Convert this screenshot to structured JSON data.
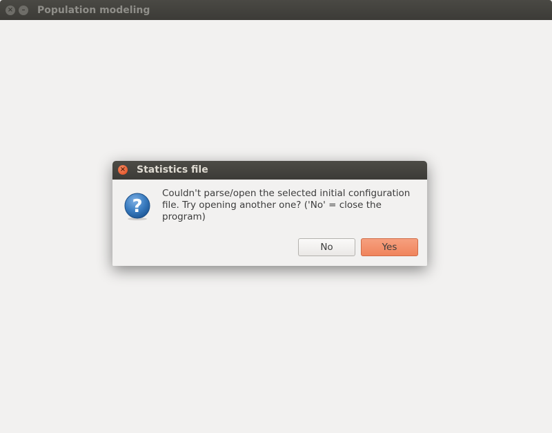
{
  "main_window": {
    "title": "Population modeling",
    "close_glyph": "×",
    "minimize_glyph": "–"
  },
  "dialog": {
    "title": "Statistics file",
    "close_glyph": "×",
    "icon": "question-icon",
    "message_line1": "Couldn't parse/open the selected initial configuration",
    "message_line2": "file. Try opening another one? ('No' = close the program)",
    "no_label": "No",
    "yes_label": "Yes"
  },
  "colors": {
    "background": "#f2f1f0",
    "titlebar": "#3c3b37",
    "accent_button": "#f0845c",
    "close_button": "#e0471c",
    "question_icon": "#2f6fb1"
  }
}
